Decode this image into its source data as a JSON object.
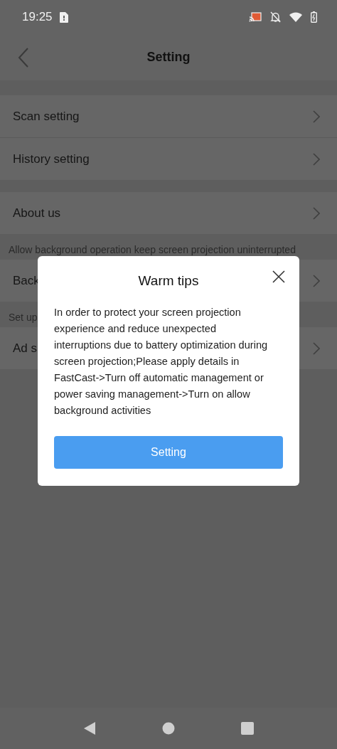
{
  "status_bar": {
    "time": "19:25"
  },
  "header": {
    "title": "Setting"
  },
  "sections": [
    {
      "rows": [
        {
          "label": "Scan setting"
        },
        {
          "label": "History setting"
        }
      ]
    },
    {
      "rows": [
        {
          "label": "About us"
        }
      ]
    },
    {
      "caption": "Allow background operation keep screen projection uninterrupted",
      "rows": [
        {
          "label": "Back"
        }
      ]
    },
    {
      "caption": "Set up",
      "rows": [
        {
          "label": "Ad s"
        }
      ]
    }
  ],
  "dialog": {
    "title": "Warm tips",
    "message": "In order to protect your screen projection experience and reduce unexpected interruptions due to battery optimization during screen projection;Please apply details in FastCast->Turn off automatic management or power saving management->Turn on allow background activities",
    "button": "Setting"
  }
}
